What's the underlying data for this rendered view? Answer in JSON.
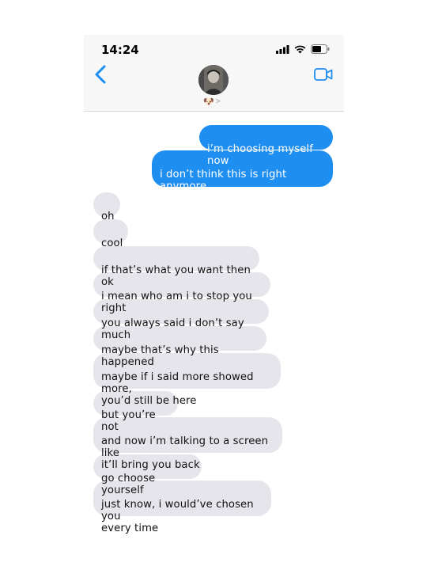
{
  "status_bar": {
    "time": "14:24"
  },
  "header": {
    "contact_emoji": "🐶",
    "chevron": ">"
  },
  "icons": {
    "back": "chevron-left-icon",
    "video": "video-call-icon",
    "signal": "signal-icon",
    "wifi": "wifi-icon",
    "battery": "battery-icon"
  },
  "colors": {
    "accent": "#1f8ef1",
    "received_bubble": "#e6e5eb"
  },
  "messages": {
    "sent": [
      "i’m choosing myself now",
      "i don’t think this is right anymore,\njeno."
    ],
    "received": [
      "oh",
      "cool",
      "if that’s what you want then ok",
      "i mean who am i to stop you right",
      "you always said i don’t say much",
      "maybe that’s why this happened",
      "maybe if i said more showed more,\nyou’d still be here",
      "but you’re not",
      "and now i’m talking to a screen like\nit’ll bring you back",
      "go choose yourself",
      "just know, i would’ve chosen you\nevery time"
    ]
  }
}
